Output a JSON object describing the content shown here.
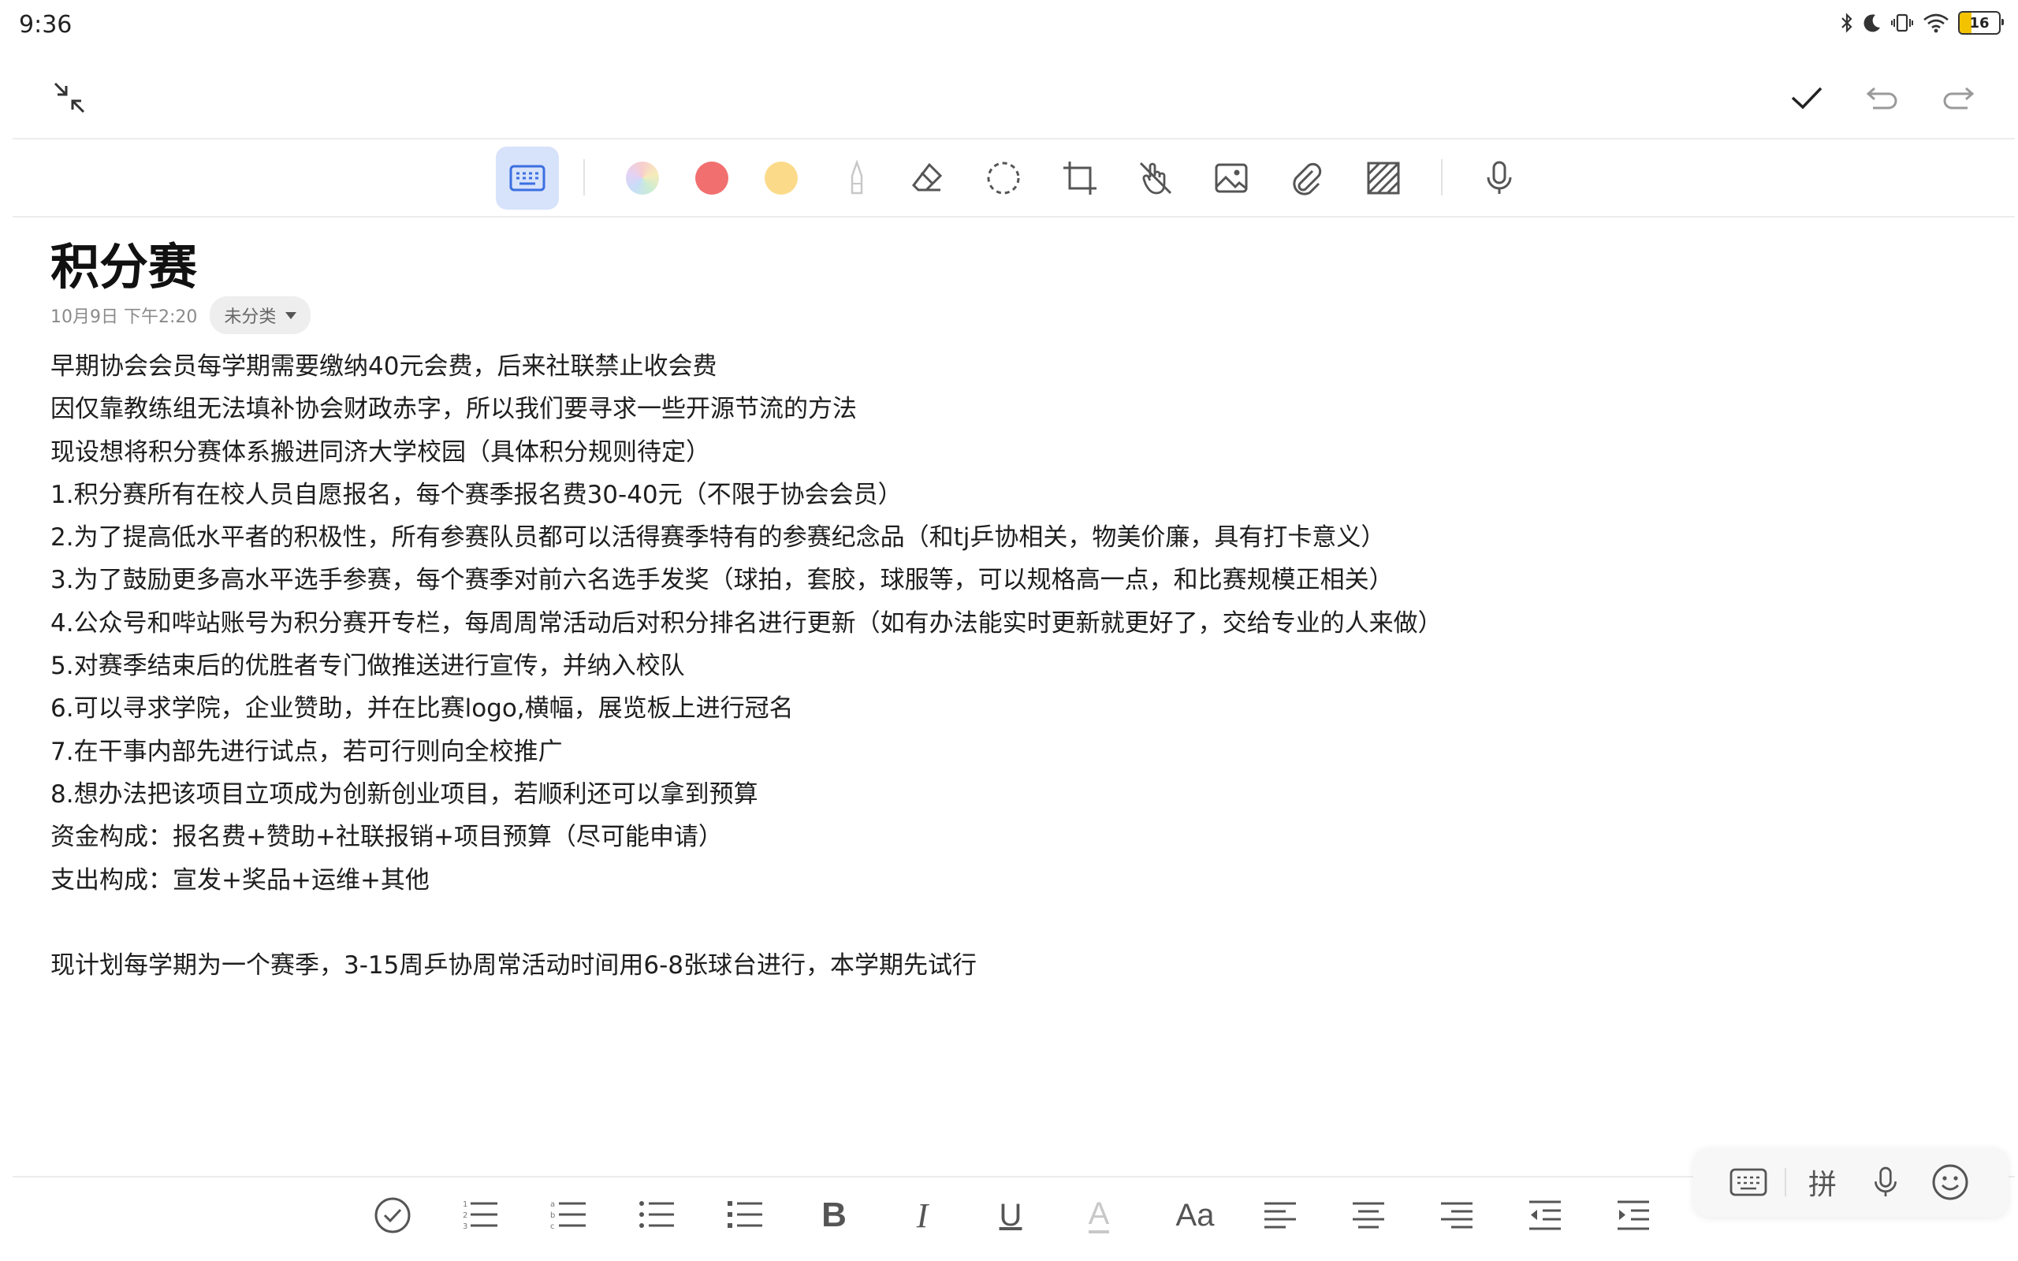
{
  "status_bar": {
    "time": "9:36",
    "battery_level": "16",
    "icons": [
      "bluetooth-icon",
      "moon-icon",
      "vibrate-icon",
      "wifi-icon",
      "battery-icon"
    ]
  },
  "top_bar": {
    "left_icon": "collapse-icon",
    "right_icons": [
      "check-icon",
      "undo-icon",
      "redo-icon"
    ]
  },
  "toolbar": {
    "tools": [
      "keyboard-icon",
      "color-rainbow",
      "color-red",
      "color-yellow",
      "pen-icon",
      "eraser-icon",
      "lasso-select-icon",
      "crop-icon",
      "finger-draw-icon",
      "image-icon",
      "attachment-icon",
      "texture-icon",
      "microphone-icon"
    ],
    "colors": {
      "red": "#f26f6f",
      "yellow": "#fbdb8a",
      "active_bg": "#d7e2fb",
      "active_icon": "#3b6fe0"
    }
  },
  "note": {
    "title": "积分赛",
    "date": "10月9日 下午2:20",
    "category": "未分类",
    "lines": [
      "早期协会会员每学期需要缴纳40元会费，后来社联禁止收会费",
      "因仅靠教练组无法填补协会财政赤字，所以我们要寻求一些开源节流的方法",
      "现设想将积分赛体系搬进同济大学校园（具体积分规则待定）",
      "1.积分赛所有在校人员自愿报名，每个赛季报名费30-40元（不限于协会会员）",
      "2.为了提高低水平者的积极性，所有参赛队员都可以活得赛季特有的参赛纪念品（和tj乒协相关，物美价廉，具有打卡意义）",
      "3.为了鼓励更多高水平选手参赛，每个赛季对前六名选手发奖（球拍，套胶，球服等，可以规格高一点，和比赛规模正相关）",
      "4.公众号和哔站账号为积分赛开专栏，每周周常活动后对积分排名进行更新（如有办法能实时更新就更好了，交给专业的人来做）",
      "5.对赛季结束后的优胜者专门做推送进行宣传，并纳入校队",
      "6.可以寻求学院，企业赞助，并在比赛logo,横幅，展览板上进行冠名",
      "7.在干事内部先进行试点，若可行则向全校推广",
      "8.想办法把该项目立项成为创新创业项目，若顺利还可以拿到预算",
      "资金构成：报名费+赞助+社联报销+项目预算（尽可能申请）",
      "支出构成：宣发+奖品+运维+其他",
      "",
      "现计划每学期为一个赛季，3-15周乒协周常活动时间用6-8张球台进行，本学期先试行"
    ]
  },
  "format_bar": {
    "tools": [
      "checklist-icon",
      "numbered-list-icon",
      "lettered-list-icon",
      "bullet-list-icon",
      "square-bullet-list-icon",
      "bold-icon",
      "italic-icon",
      "underline-icon",
      "text-color-icon",
      "font-size-icon",
      "align-left-icon",
      "align-center-icon",
      "align-right-icon",
      "outdent-icon",
      "indent-icon"
    ],
    "bold_label": "B",
    "italic_label": "I",
    "underline_label": "U",
    "text_color_label": "A",
    "font_size_label": "Aa"
  },
  "ime_panel": {
    "pinyin_label": "拼",
    "icons": [
      "keyboard-icon",
      "microphone-icon",
      "emoji-icon"
    ]
  }
}
